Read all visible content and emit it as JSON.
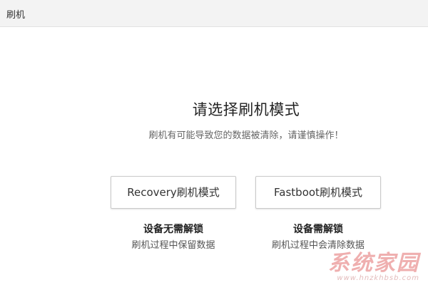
{
  "window": {
    "title": "刷机"
  },
  "main": {
    "heading": "请选择刷机模式",
    "subtitle": "刷机有可能导致您的数据被清除，请谨慎操作！"
  },
  "modes": [
    {
      "button_label": "Recovery刷机模式",
      "title": "设备无需解锁",
      "description": "刷机过程中保留数据"
    },
    {
      "button_label": "Fastboot刷机模式",
      "title": "设备需解锁",
      "description": "刷机过程中会清除数据"
    }
  ],
  "watermark": {
    "main": "系统家园",
    "sub": "www.hnzkhbsb.com"
  },
  "colors": {
    "titlebar_bg": "#f3f3f3",
    "button_border": "#c9c9c9",
    "watermark": "#e16e6e"
  }
}
